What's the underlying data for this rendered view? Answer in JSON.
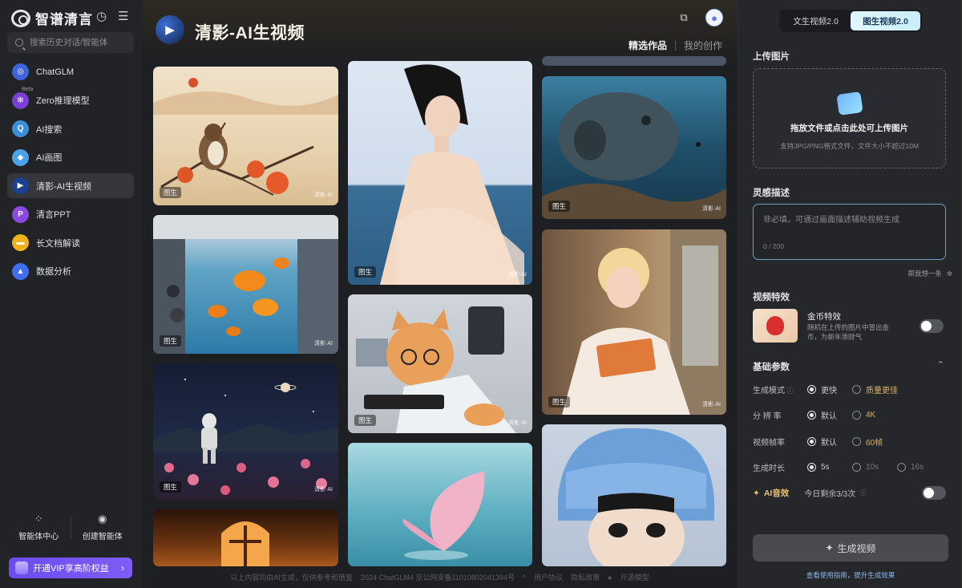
{
  "brand": {
    "name": "智谱清言"
  },
  "sidebar": {
    "search_placeholder": "搜索历史对话/智能体",
    "items": [
      {
        "label": "ChatGLM",
        "icon": "chatglm-icon",
        "color": "#3d63dd",
        "glyph": "◎"
      },
      {
        "label": "Zero推理模型",
        "icon": "atom-icon",
        "color": "#7a3fd6",
        "glyph": "✻",
        "badge": "Beta"
      },
      {
        "label": "AI搜索",
        "icon": "ai-search-icon",
        "color": "#3b8fd9",
        "glyph": "Q"
      },
      {
        "label": "AI画图",
        "icon": "ai-paint-icon",
        "color": "#4aa3e8",
        "glyph": "◆"
      },
      {
        "label": "清影-AI生视频",
        "icon": "video-icon",
        "color": "#1d3f8f",
        "glyph": "▶",
        "active": true
      },
      {
        "label": "清言PPT",
        "icon": "ppt-icon",
        "color": "#8a4ae0",
        "glyph": "P"
      },
      {
        "label": "长文档解读",
        "icon": "folder-icon",
        "color": "#f0b21c",
        "glyph": "▬"
      },
      {
        "label": "数据分析",
        "icon": "chart-icon",
        "color": "#3f6ef0",
        "glyph": "▲"
      }
    ],
    "agent_center": "智能体中心",
    "create_agent": "创建智能体",
    "vip_label": "开通VIP享高阶权益"
  },
  "main": {
    "app_title": "清影-AI生视频",
    "tab_selected": "精选作品",
    "tab_other": "我的创作",
    "badge": "图生",
    "watermark": "清影·AI",
    "footer": {
      "disclaimer": "以上内容均由AI生成，仅供参考和借鉴",
      "icp": "2024 ChatGLM4 京公网安备11010802041394号",
      "terms": "用户协议",
      "privacy": "隐私政策",
      "opensource": "开源模型"
    }
  },
  "panel": {
    "mode_text": "文生视频2.0",
    "mode_image": "图生视频2.0",
    "upload_title": "上传图片",
    "upload_main": "拖放文件或点击此处可上传图片",
    "upload_sub": "支持JPG/PNG格式文件，文件大小不超过10M",
    "inspiration_title": "灵感描述",
    "desc_placeholder": "非必填，可通过画面描述辅助视频生成",
    "desc_count": "0 / 200",
    "helper": "帮我想一条",
    "effects_title": "视频特效",
    "effect_name": "金币特效",
    "effect_desc": "随机在上传的图片中冒出金币，为新年添财气",
    "params_title": "基础参数",
    "mode_label": "生成模式",
    "mode_fast": "更快",
    "mode_quality": "质量更佳",
    "res_label": "分 辨 率",
    "res_default": "默认",
    "res_4k": "4K",
    "fps_label": "视频帧率",
    "fps_default": "默认",
    "fps_60": "60帧",
    "dur_label": "生成时长",
    "dur_5": "5s",
    "dur_10": "10s",
    "dur_16": "16s",
    "sfx_label": "AI音效",
    "sfx_quota": "今日剩余3/3次",
    "generate": "生成视频",
    "guide": "查看使用指南，提升生成效果"
  }
}
